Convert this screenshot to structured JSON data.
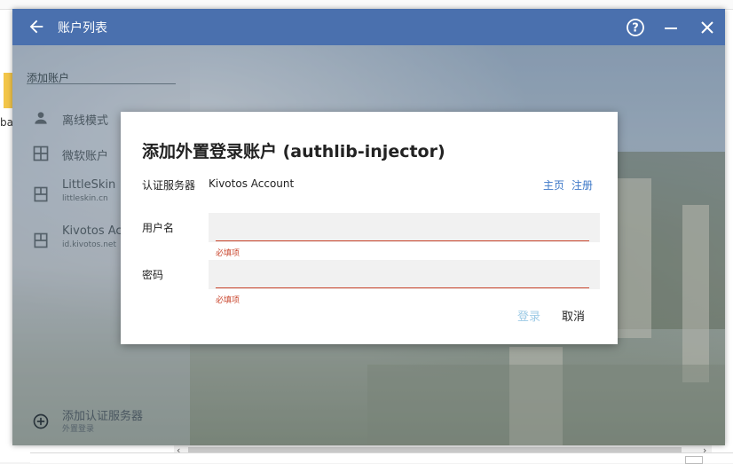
{
  "desktop": {
    "partial_label": "ba"
  },
  "window": {
    "title": "账户列表",
    "help_icon": "help-circle-icon",
    "minimize_icon": "minimize-icon",
    "close_icon": "close-icon"
  },
  "sidebar": {
    "section_label": "添加账户",
    "items": [
      {
        "label": "离线模式",
        "sub": "",
        "icon": "person-icon"
      },
      {
        "label": "微软账户",
        "sub": "",
        "icon": "windows-grid-icon"
      },
      {
        "label": "LittleSkin",
        "sub": "littleskin.cn",
        "icon": "server-icon"
      },
      {
        "label": "Kivotos Ac",
        "sub": "id.kivotos.net",
        "icon": "server-icon"
      }
    ],
    "add_server": {
      "label": "添加认证服务器",
      "sub": "外置登录",
      "icon": "add-circle-icon"
    }
  },
  "dialog": {
    "title": "添加外置登录账户 (authlib-injector)",
    "server_label": "认证服务器",
    "server_value": "Kivotos Account",
    "homepage_link": "主页",
    "register_link": "注册",
    "username_label": "用户名",
    "username_value": "",
    "username_error": "必填项",
    "password_label": "密码",
    "password_value": "",
    "password_error": "必填项",
    "login_button": "登录",
    "cancel_button": "取消"
  },
  "colors": {
    "titlebar": "#4a70ae",
    "link": "#3b77c7",
    "error": "#c9442b",
    "disabled_button": "#9ecbe6"
  }
}
